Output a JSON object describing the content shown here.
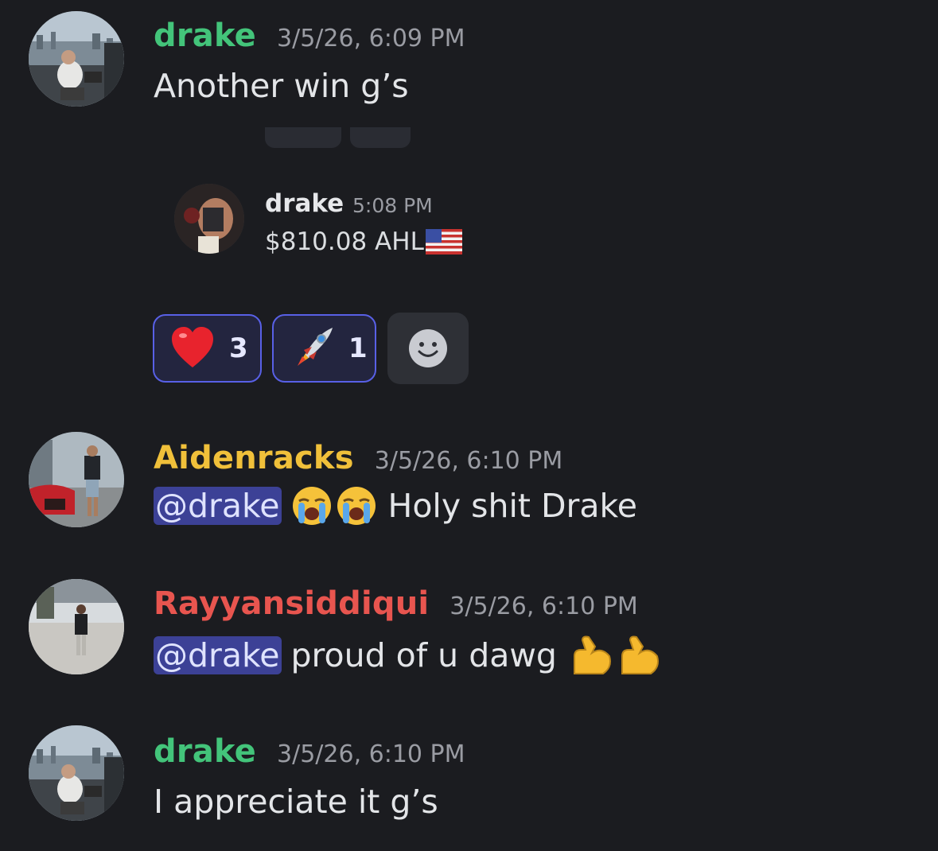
{
  "messages": [
    {
      "username": "drake",
      "username_color": "#43c47a",
      "timestamp": "3/5/26, 6:09 PM",
      "text": "Another win g’s"
    },
    {
      "username": "Aidenracks",
      "username_color": "#f0c03a",
      "timestamp": "3/5/26, 6:10 PM",
      "mention": "@drake",
      "text": "Holy shit Drake"
    },
    {
      "username": "Rayyansiddiqui",
      "username_color": "#e8554f",
      "timestamp": "3/5/26, 6:10 PM",
      "mention": "@drake",
      "text": "proud of u dawg"
    },
    {
      "username": "drake",
      "username_color": "#43c47a",
      "timestamp": "3/5/26, 6:10 PM",
      "text": "I appreciate it g’s"
    }
  ],
  "embed": {
    "username": "drake",
    "timestamp": "5:08 PM",
    "text": "$810.08 AHL",
    "flag_icon": "us-flag-icon"
  },
  "reactions": [
    {
      "emoji": "heart-icon",
      "count": "3"
    },
    {
      "emoji": "rocket-icon",
      "count": "1"
    }
  ],
  "add_reaction_icon": "smiley-icon"
}
